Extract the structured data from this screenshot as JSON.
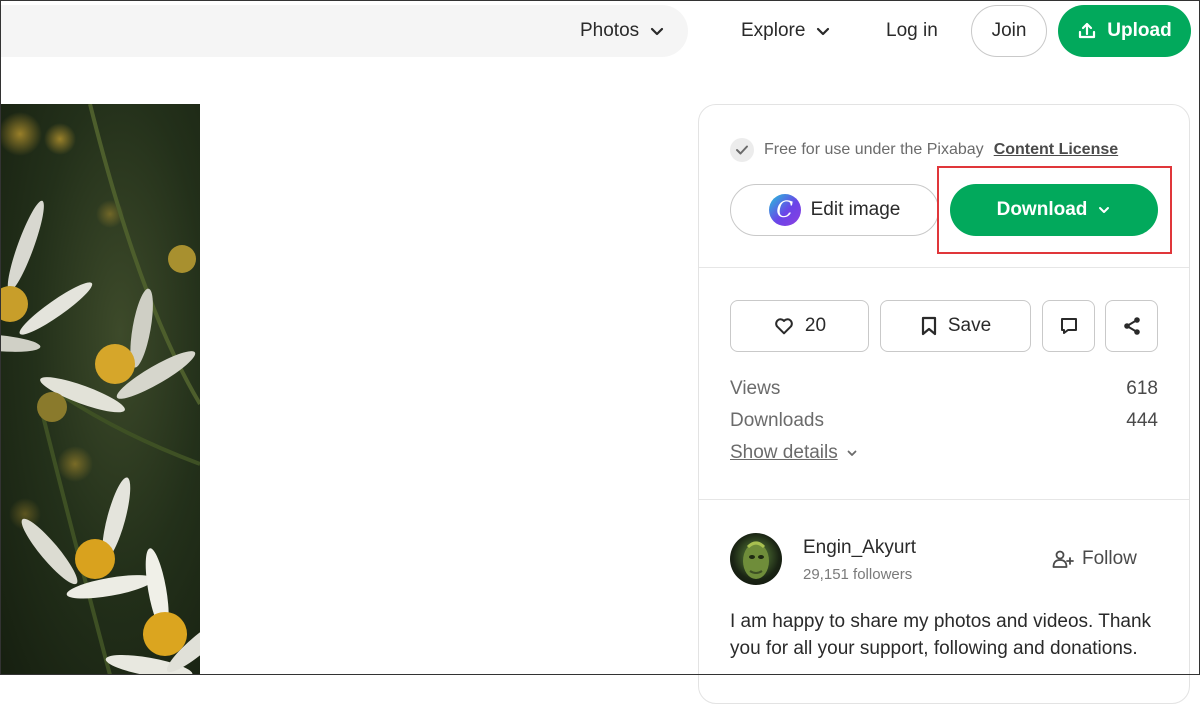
{
  "header": {
    "media_type_select": "Photos",
    "explore_label": "Explore",
    "login_label": "Log in",
    "join_label": "Join",
    "upload_label": "Upload"
  },
  "panel": {
    "license_text": "Free for use under the Pixabay",
    "license_link": "Content License",
    "edit_image_label": "Edit image",
    "download_label": "Download",
    "likes_count": "20",
    "save_label": "Save",
    "stats": [
      {
        "label": "Views",
        "value": "618"
      },
      {
        "label": "Downloads",
        "value": "444"
      }
    ],
    "show_details_label": "Show details",
    "author": {
      "name": "Engin_Akyurt",
      "followers": "29,151 followers",
      "follow_label": "Follow",
      "bio": "I am happy to share my photos and videos. Thank you for all your support, following and donations."
    }
  },
  "colors": {
    "accent_green": "#02a95c",
    "highlight_red": "#e0363a"
  },
  "icons": [
    "chevron-down-icon",
    "upload-icon",
    "check-icon",
    "canva-logo-icon",
    "heart-icon",
    "bookmark-icon",
    "comment-icon",
    "share-icon",
    "add-user-icon"
  ]
}
